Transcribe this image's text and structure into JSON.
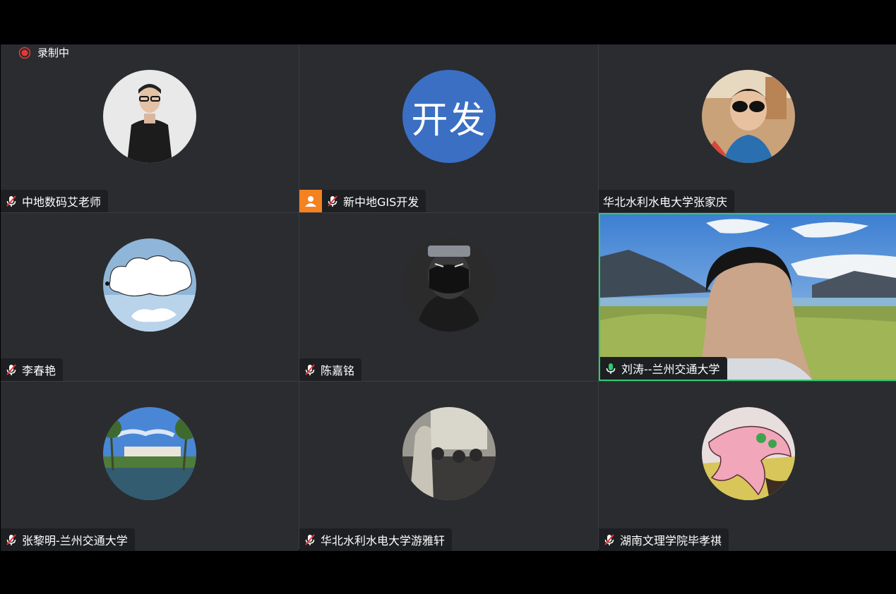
{
  "recording": {
    "label": "录制中"
  },
  "participants": [
    {
      "name": "中地数码艾老师",
      "mic": "muted",
      "avatar": "person-photo-icon"
    },
    {
      "name": "新中地GIS开发",
      "mic": "muted",
      "avatar_text": "开发",
      "avatar_color": "#3a6fc4",
      "role": "host-badge-icon"
    },
    {
      "name": "华北水利水电大学张家庆",
      "mic": "none",
      "avatar": "sunglasses-photo-icon"
    },
    {
      "name": "李春艳",
      "mic": "muted",
      "avatar": "cloud-dog-icon"
    },
    {
      "name": "陈嘉铭",
      "mic": "muted",
      "avatar": "ninja-icon"
    },
    {
      "name": "刘涛--兰州交通大学",
      "mic": "active",
      "video": "landscape-video"
    },
    {
      "name": "张黎明-兰州交通大学",
      "mic": "muted",
      "avatar": "campus-lake-icon"
    },
    {
      "name": "华北水利水电大学游雅轩",
      "mic": "muted",
      "avatar": "classroom-photo-icon"
    },
    {
      "name": "湖南文理学院毕孝祺",
      "mic": "muted",
      "avatar": "starfish-icon"
    }
  ],
  "colors": {
    "active_border": "#2ecc71",
    "record": "#e53935",
    "mic_active": "#2ecc71",
    "mic_muted": "#e53935",
    "host_badge": "#f58220"
  }
}
